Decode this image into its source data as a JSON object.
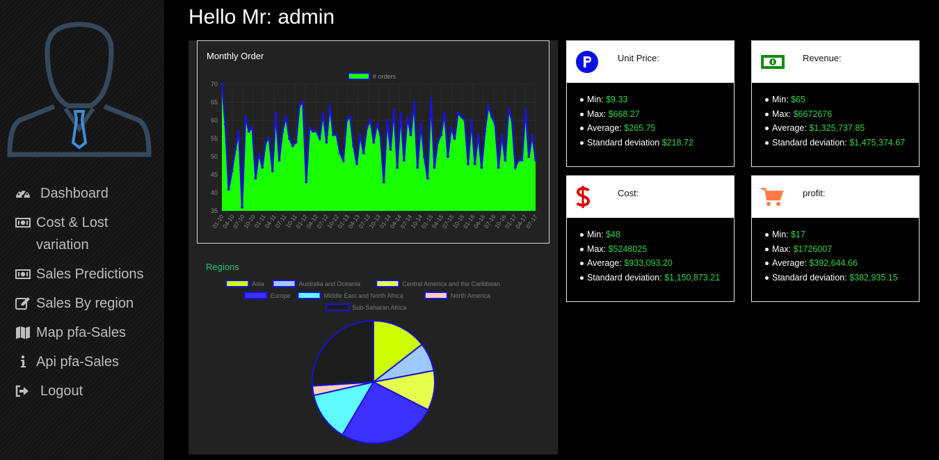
{
  "header": {
    "greeting": "Hello Mr: admin"
  },
  "sidebar": {
    "items": [
      {
        "label": "Dashboard",
        "icon": "dashboard-gauge-icon"
      },
      {
        "label": "Cost & Lost variation",
        "icon": "money-icon"
      },
      {
        "label": "Sales Predictions",
        "icon": "money-icon"
      },
      {
        "label": "Sales By region",
        "icon": "edit-icon"
      },
      {
        "label": "Map pfa-Sales",
        "icon": "map-icon"
      },
      {
        "label": "Api pfa-Sales",
        "icon": "info-icon"
      },
      {
        "label": "Logout",
        "icon": "logout-icon"
      }
    ]
  },
  "cards": [
    {
      "title": "Unit Price:",
      "icon": "parking-circle-icon",
      "icon_color": "#0a0fe6",
      "stats": [
        {
          "label": "Min:",
          "value": "$9.33"
        },
        {
          "label": "Max:",
          "value": "$668.27"
        },
        {
          "label": "Average:",
          "value": "$265.75"
        },
        {
          "label": "Standard deviation",
          "value": "$218.72"
        }
      ]
    },
    {
      "title": "Revenue:",
      "icon": "money-bill-icon",
      "icon_color": "#138a13",
      "stats": [
        {
          "label": "Min:",
          "value": "$65"
        },
        {
          "label": "Max:",
          "value": "$6672676"
        },
        {
          "label": "Average:",
          "value": "$1,325,737.85"
        },
        {
          "label": "Standard deviation:",
          "value": "$1,475,374.67"
        }
      ]
    },
    {
      "title": "Cost:",
      "icon": "dollar-sign-icon",
      "icon_color": "#e00000",
      "stats": [
        {
          "label": "Min:",
          "value": "$48"
        },
        {
          "label": "Max:",
          "value": "$5248025"
        },
        {
          "label": "Average:",
          "value": "$933,093.20"
        },
        {
          "label": "Standard deviation:",
          "value": "$1,150,873.21"
        }
      ]
    },
    {
      "title": "profit:",
      "icon": "shopping-cart-icon",
      "icon_color": "#ff7a45",
      "stats": [
        {
          "label": "Min:",
          "value": "$17"
        },
        {
          "label": "Max:",
          "value": "$1726007"
        },
        {
          "label": "Average:",
          "value": "$392,644.66"
        },
        {
          "label": "Standard deviation:",
          "value": "$382,935.15"
        }
      ]
    }
  ],
  "accent_colors": {
    "value_green": "#31d64a",
    "chart_fill": "#1aff00",
    "chart_line": "#1a12d8",
    "regions_title": "#17c27b"
  },
  "chart_data": [
    {
      "type": "area",
      "title": "Monthly Order",
      "legend": [
        "# orders"
      ],
      "legend_position": "top-center",
      "ylim": [
        35,
        70
      ],
      "yticks": [
        35,
        40,
        45,
        50,
        55,
        60,
        65,
        70
      ],
      "xtick_labels": [
        "01-10",
        "04-10",
        "07-10",
        "10-10",
        "01-11",
        "04-11",
        "07-11",
        "10-11",
        "01-12",
        "04-12",
        "07-12",
        "10-12",
        "01-13",
        "04-13",
        "07-13",
        "10-13",
        "01-14",
        "04-14",
        "07-14",
        "10-14",
        "01-15",
        "04-15",
        "07-15",
        "10-15",
        "01-16",
        "04-16",
        "07-16",
        "10-16",
        "01-17",
        "04-17",
        "07-17"
      ],
      "series": [
        {
          "name": "# orders",
          "values": [
            70,
            59,
            41,
            46,
            52,
            57,
            36,
            61,
            57,
            58,
            44,
            51,
            47,
            54,
            55,
            46,
            62,
            49,
            57,
            61,
            55,
            53,
            54,
            64,
            65,
            43,
            58,
            57,
            57,
            55,
            62,
            54,
            64,
            56,
            56,
            51,
            49,
            60,
            61,
            53,
            48,
            56,
            51,
            58,
            60,
            54,
            59,
            56,
            43,
            60,
            52,
            63,
            47,
            62,
            49,
            61,
            56,
            65,
            47,
            59,
            50,
            44,
            66,
            47,
            54,
            56,
            62,
            50,
            58,
            55,
            62,
            61,
            60,
            48,
            60,
            48,
            56,
            47,
            57,
            64,
            61,
            59,
            47,
            56,
            49,
            63,
            60,
            47,
            49,
            49,
            63,
            50,
            56,
            49
          ]
        }
      ]
    },
    {
      "type": "pie",
      "title": "Regions",
      "legend_position": "top",
      "categories": [
        "Asia",
        "Australia and Oceania",
        "Central America and the Caribbean",
        "Europe",
        "Middle East and North Africa",
        "North America",
        "Sub-Saharan Africa"
      ],
      "values": [
        14.5,
        7.5,
        10.5,
        26.0,
        13.0,
        2.5,
        26.0
      ],
      "colors": [
        "#ccff00",
        "#9ec9ff",
        "#e6ff4d",
        "#3b30ff",
        "#5ffbff",
        "#ffcfc0",
        "#1c1c1c"
      ]
    }
  ]
}
